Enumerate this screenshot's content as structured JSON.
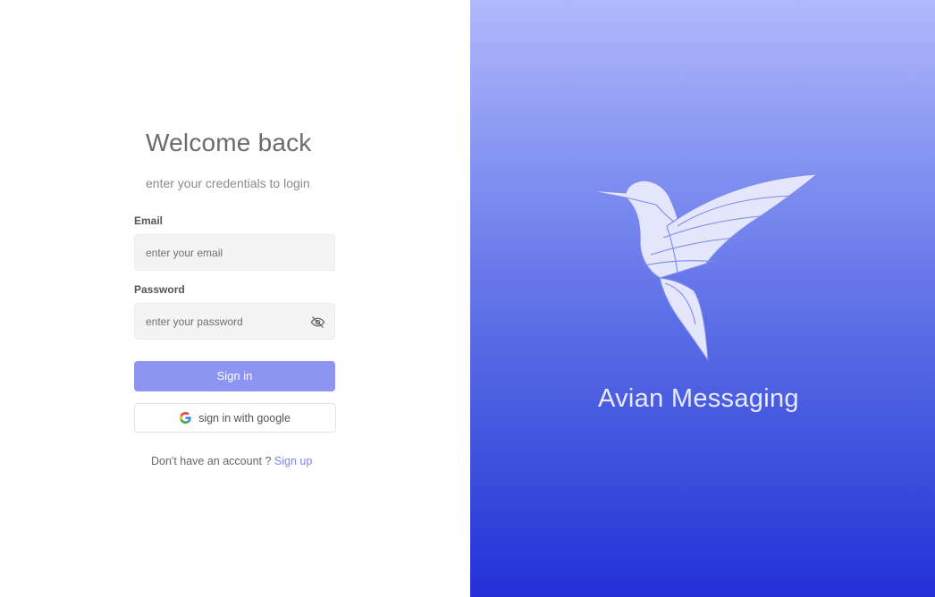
{
  "login": {
    "title": "Welcome back",
    "subtitle": "enter your credentials to login",
    "email_label": "Email",
    "email_placeholder": "enter your email",
    "email_value": "",
    "password_label": "Password",
    "password_placeholder": "enter your password",
    "password_value": "",
    "password_toggle_icon": "eye-off-icon",
    "signin_label": "Sign in",
    "google_label": "sign in with google",
    "google_icon": "google-icon",
    "no_account_text": "Don't have an account ?",
    "signup_label": "Sign up"
  },
  "brand": {
    "name": "Avian Messaging",
    "logo_icon": "hummingbird-logo"
  },
  "colors": {
    "accent": "#8d95f3",
    "link": "#7b86f0",
    "panel_gradient_top": "#b1b8fb",
    "panel_gradient_bottom": "#2330d8"
  }
}
